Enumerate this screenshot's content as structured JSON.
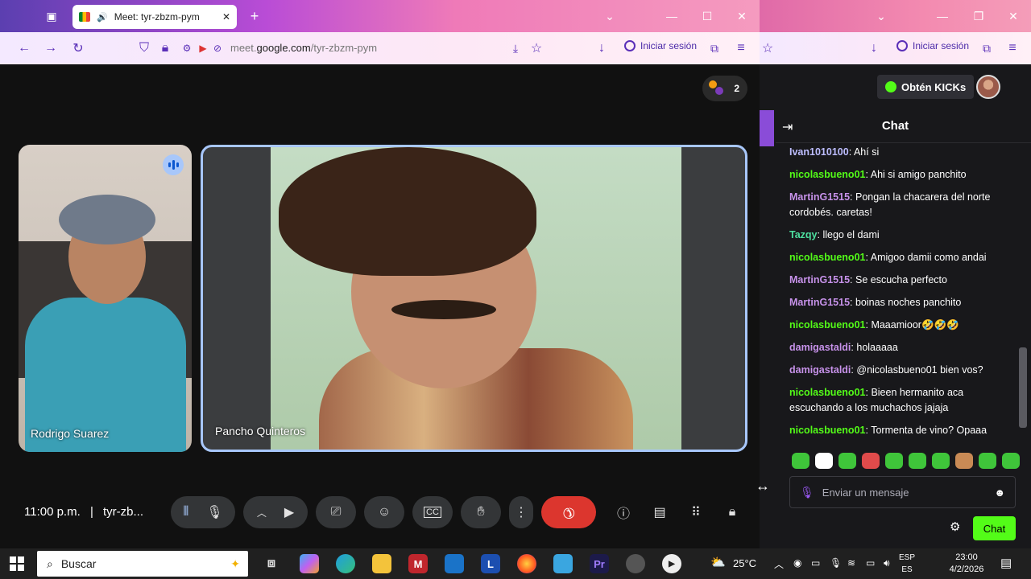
{
  "browser_left": {
    "tab_title": "Meet: tyr-zbzm-pym",
    "url_prefix": "meet.",
    "url_domain": "google.com",
    "url_path": "/tyr-zbzm-pym",
    "signin_label": "Iniciar sesión"
  },
  "browser_right": {
    "signin_label": "Iniciar sesión"
  },
  "meet": {
    "participant_count": "2",
    "participants": [
      {
        "name": "Rodrigo Suarez"
      },
      {
        "name": "Pancho Quinteros"
      }
    ],
    "time": "11:00 p.m.",
    "separator": "|",
    "meeting_code_short": "tyr-zb..."
  },
  "kick": {
    "kicks_button": "Obtén KICKs",
    "chat_title": "Chat",
    "messages": [
      {
        "user": "Ivan1010100",
        "color": "#bdbdff",
        "text": "Ahí si"
      },
      {
        "user": "nicolasbueno01",
        "color": "#53fc18",
        "text": "Ahi si amigo panchito"
      },
      {
        "user": "MartinG1515",
        "color": "#c792ea",
        "text": "Pongan la chacarera del norte cordobés. caretas!"
      },
      {
        "user": "Tazqy",
        "color": "#4ee0a0",
        "text": "llego el dami"
      },
      {
        "user": "nicolasbueno01",
        "color": "#53fc18",
        "text": "Amigoo damii como andai"
      },
      {
        "user": "MartinG1515",
        "color": "#c792ea",
        "text": "Se escucha perfecto"
      },
      {
        "user": "MartinG1515",
        "color": "#c792ea",
        "text": "boinas noches panchito"
      },
      {
        "user": "nicolasbueno01",
        "color": "#53fc18",
        "text": "Maaamioor🤣🤣🤣"
      },
      {
        "user": "damigastaldi",
        "color": "#c792ea",
        "text": "holaaaaa"
      },
      {
        "user": "damigastaldi",
        "color": "#c792ea",
        "text": "@nicolasbueno01 bien vos?"
      },
      {
        "user": "nicolasbueno01",
        "color": "#53fc18",
        "text": "Bieen hermanito aca escuchando a los muchachos jajaja"
      },
      {
        "user": "nicolasbueno01",
        "color": "#53fc18",
        "text": "Tormenta de vino? Opaaa"
      }
    ],
    "input_placeholder": "Enviar un mensaje",
    "send_label": "Chat"
  },
  "taskbar": {
    "search_placeholder": "Buscar",
    "weather": "25°C",
    "lang_top": "ESP",
    "lang_bottom": "ES",
    "time": "23:00",
    "date": "4/2/2026"
  },
  "colors": {
    "accent_meet": "#a8c7fa",
    "end_call": "#dc362e",
    "kick_green": "#53fc18"
  }
}
